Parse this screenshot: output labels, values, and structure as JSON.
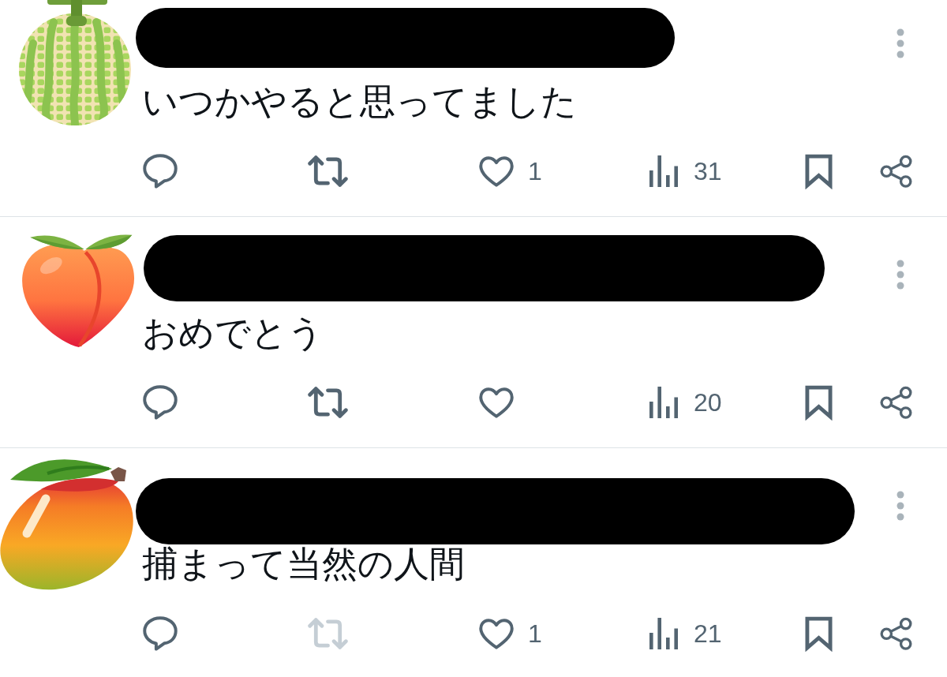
{
  "posts": [
    {
      "avatar": {
        "kind": "melon"
      },
      "name_redacted": true,
      "text": "いつかやると思ってました",
      "actions": [
        {
          "kind": "reply"
        },
        {
          "kind": "retweet",
          "disabled": false
        },
        {
          "kind": "like",
          "count": "1"
        },
        {
          "kind": "views",
          "count": "31"
        },
        {
          "kind": "bookmark"
        },
        {
          "kind": "share"
        }
      ]
    },
    {
      "avatar": {
        "kind": "peach"
      },
      "name_redacted": true,
      "text": "おめでとう",
      "actions": [
        {
          "kind": "reply"
        },
        {
          "kind": "retweet",
          "disabled": false
        },
        {
          "kind": "like"
        },
        {
          "kind": "views",
          "count": "20"
        },
        {
          "kind": "bookmark"
        },
        {
          "kind": "share"
        }
      ]
    },
    {
      "avatar": {
        "kind": "mango"
      },
      "name_redacted": true,
      "text": "捕まって当然の人間",
      "actions": [
        {
          "kind": "reply"
        },
        {
          "kind": "retweet",
          "disabled": true
        },
        {
          "kind": "like",
          "count": "1"
        },
        {
          "kind": "views",
          "count": "21"
        },
        {
          "kind": "bookmark"
        },
        {
          "kind": "share"
        }
      ]
    }
  ]
}
